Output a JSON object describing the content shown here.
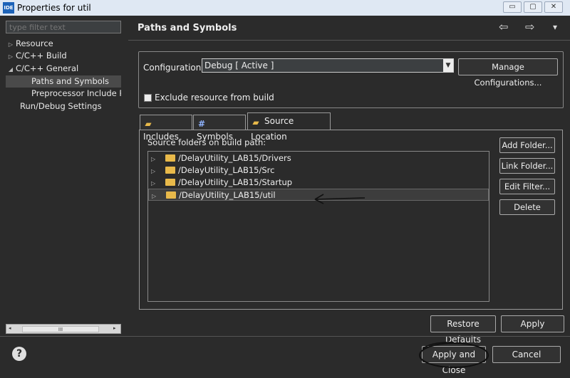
{
  "window": {
    "app_icon_text": "IDE",
    "title": "Properties for util",
    "minimize_glyph": "▭",
    "maximize_glyph": "▢",
    "close_glyph": "✕"
  },
  "sidebar": {
    "filter_placeholder": "type filter text",
    "items": [
      {
        "label": "Resource",
        "twisty": "▷"
      },
      {
        "label": "C/C++ Build",
        "twisty": "▷"
      },
      {
        "label": "C/C++ General",
        "twisty": "◢"
      },
      {
        "label": "Paths and Symbols",
        "twisty": ""
      },
      {
        "label": "Preprocessor Include Pat",
        "twisty": ""
      },
      {
        "label": "Run/Debug Settings",
        "twisty": ""
      }
    ],
    "scroll_left": "◂",
    "scroll_right": "▸",
    "scroll_thumb": "III"
  },
  "header": {
    "title": "Paths and Symbols",
    "back_glyph": "⇦",
    "forward_glyph": "⇨",
    "menu_glyph": "▾"
  },
  "configuration": {
    "label": "Configuration:",
    "value": "Debug  [ Active ]",
    "manage_button": "Manage Configurations...",
    "exclude_label": "Exclude resource from build"
  },
  "tabs": [
    {
      "label": "Includes",
      "icon": "📂"
    },
    {
      "label": "Symbols",
      "icon": "#"
    },
    {
      "label": "Source Location",
      "icon": "📂"
    }
  ],
  "source_location": {
    "section_label": "Source folders on build path:",
    "folders": [
      {
        "path": "/DelayUtility_LAB15/Drivers"
      },
      {
        "path": "/DelayUtility_LAB15/Src"
      },
      {
        "path": "/DelayUtility_LAB15/Startup"
      },
      {
        "path": "/DelayUtility_LAB15/util"
      }
    ],
    "twisty": "▷",
    "buttons": {
      "add_folder": "Add Folder...",
      "link_folder": "Link Folder...",
      "edit_filter": "Edit Filter...",
      "delete": "Delete"
    }
  },
  "footer": {
    "restore_defaults": "Restore Defaults",
    "apply": "Apply",
    "apply_and_close": "Apply and Close",
    "cancel": "Cancel",
    "help_glyph": "?"
  },
  "colors": {
    "background": "#2b2b2b",
    "title_bar": "#dfe8f3",
    "folder_icon": "#e8b94a"
  }
}
